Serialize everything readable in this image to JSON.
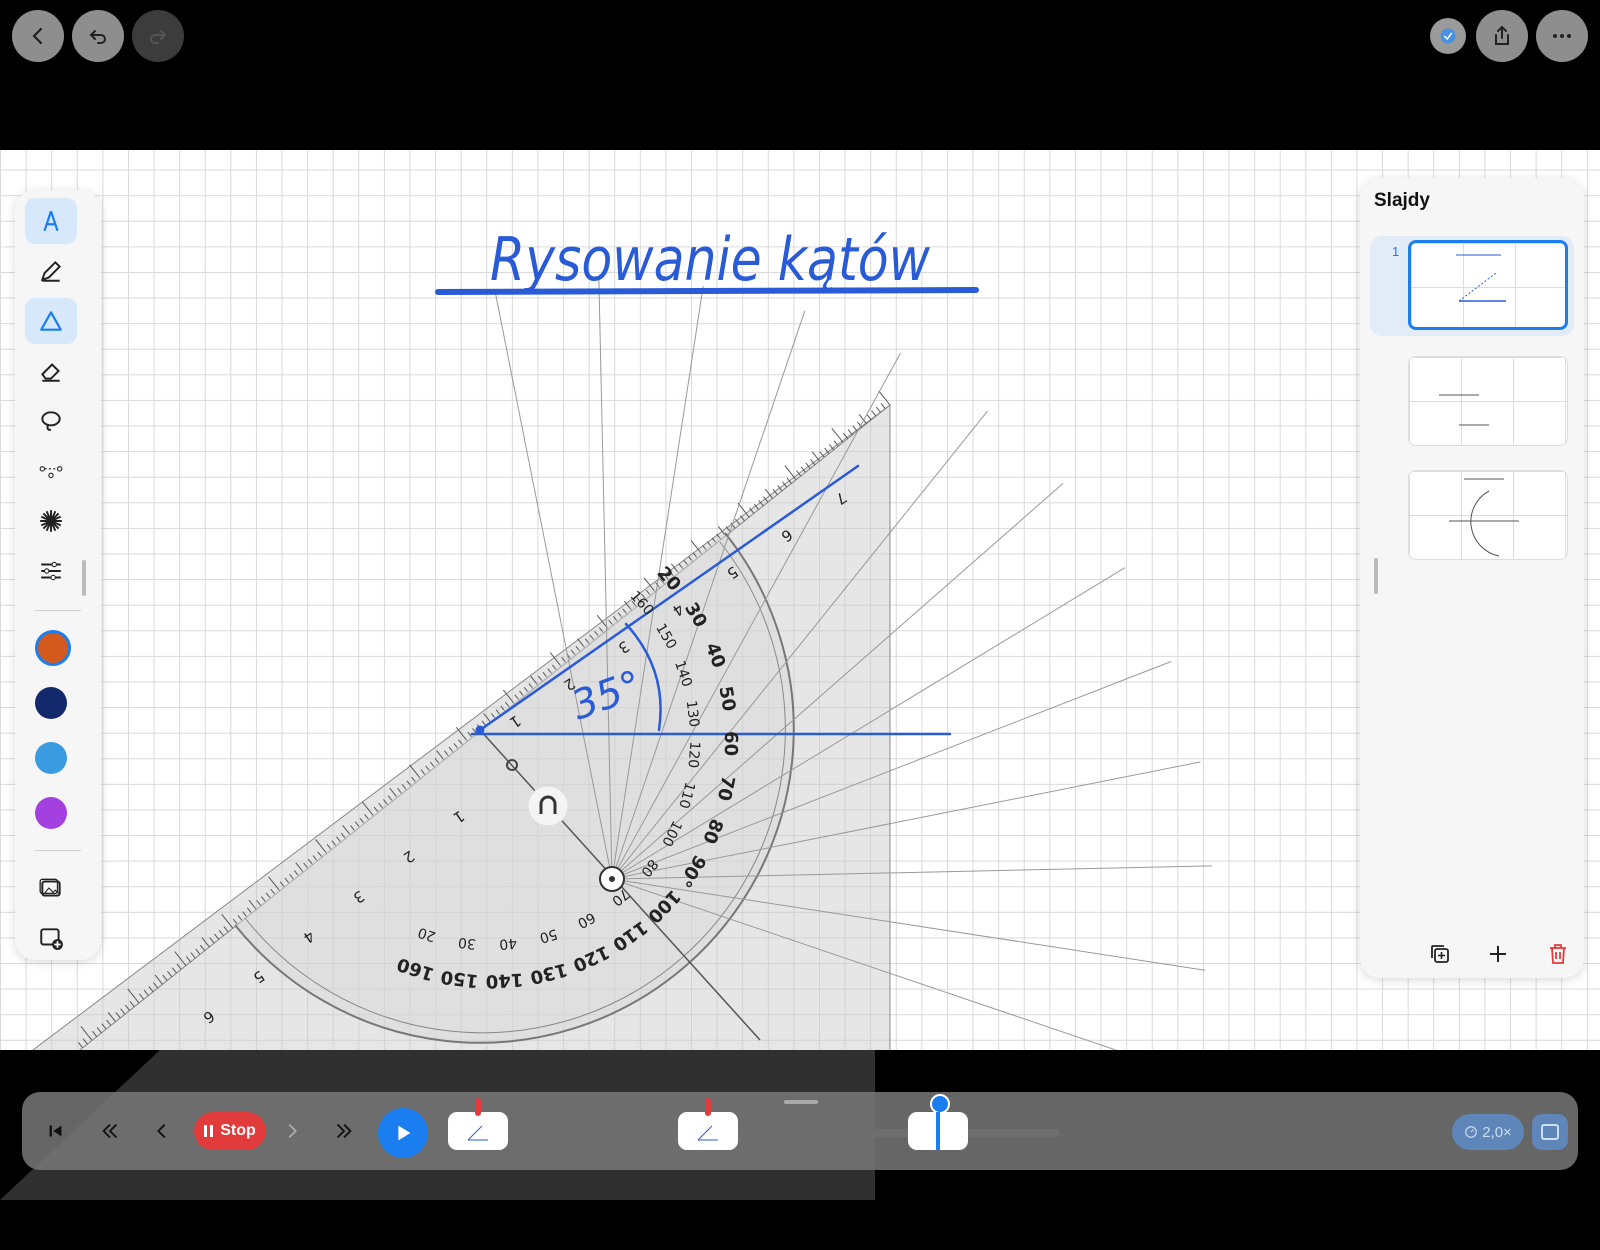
{
  "top_bar": {
    "back_icon": "chevron-left-icon",
    "undo_icon": "undo-icon",
    "redo_icon": "redo-icon",
    "share_icon": "share-icon",
    "more_icon": "ellipsis-icon",
    "checkmark_icon": "checkmark-icon"
  },
  "canvas": {
    "title_text": "Rysowanie kątów",
    "angle_label": "35°",
    "ink_color": "#2a5bd7"
  },
  "protractor": {
    "ruler_marks": [
      "1",
      "2",
      "3",
      "4",
      "5",
      "6",
      "7"
    ],
    "ruler_marks_lower": [
      "1",
      "2",
      "3",
      "4",
      "5",
      "6"
    ],
    "outer_scale": [
      "20",
      "30",
      "40",
      "50",
      "60",
      "70",
      "80",
      "90°",
      "100",
      "110",
      "120",
      "130",
      "140",
      "150",
      "160"
    ],
    "inner_scale": [
      "160",
      "150",
      "140",
      "130",
      "120",
      "110",
      "100",
      "80",
      "70",
      "60",
      "50",
      "40",
      "30",
      "20"
    ],
    "magnet_icon": "magnet-icon"
  },
  "toolbar": {
    "tools": [
      {
        "name": "compass-tool",
        "icon": "compass-icon",
        "active": true
      },
      {
        "name": "pencil-tool",
        "icon": "pencil-icon",
        "active": false
      },
      {
        "name": "triangle-tool",
        "icon": "triangle-icon",
        "active": true
      },
      {
        "name": "eraser-tool",
        "icon": "eraser-icon",
        "active": false
      },
      {
        "name": "lasso-tool",
        "icon": "lasso-icon",
        "active": false
      },
      {
        "name": "points-tool",
        "icon": "points-icon",
        "active": false
      },
      {
        "name": "laser-tool",
        "icon": "laser-icon",
        "active": false
      },
      {
        "name": "settings-tool",
        "icon": "sliders-icon",
        "active": false
      }
    ],
    "colors": [
      "#d35a1c",
      "#12296b",
      "#3a9be0",
      "#a540e0"
    ],
    "image_icon": "image-icon",
    "add_image_icon": "add-image-icon"
  },
  "slides_panel": {
    "title": "Slajdy",
    "slide_numbers": [
      "1"
    ],
    "duplicate_icon": "duplicate-icon",
    "add_icon": "plus-icon",
    "delete_icon": "trash-icon"
  },
  "playbar": {
    "stop_label": "Stop",
    "speed_label": "2,0×",
    "keyframes": 3
  }
}
